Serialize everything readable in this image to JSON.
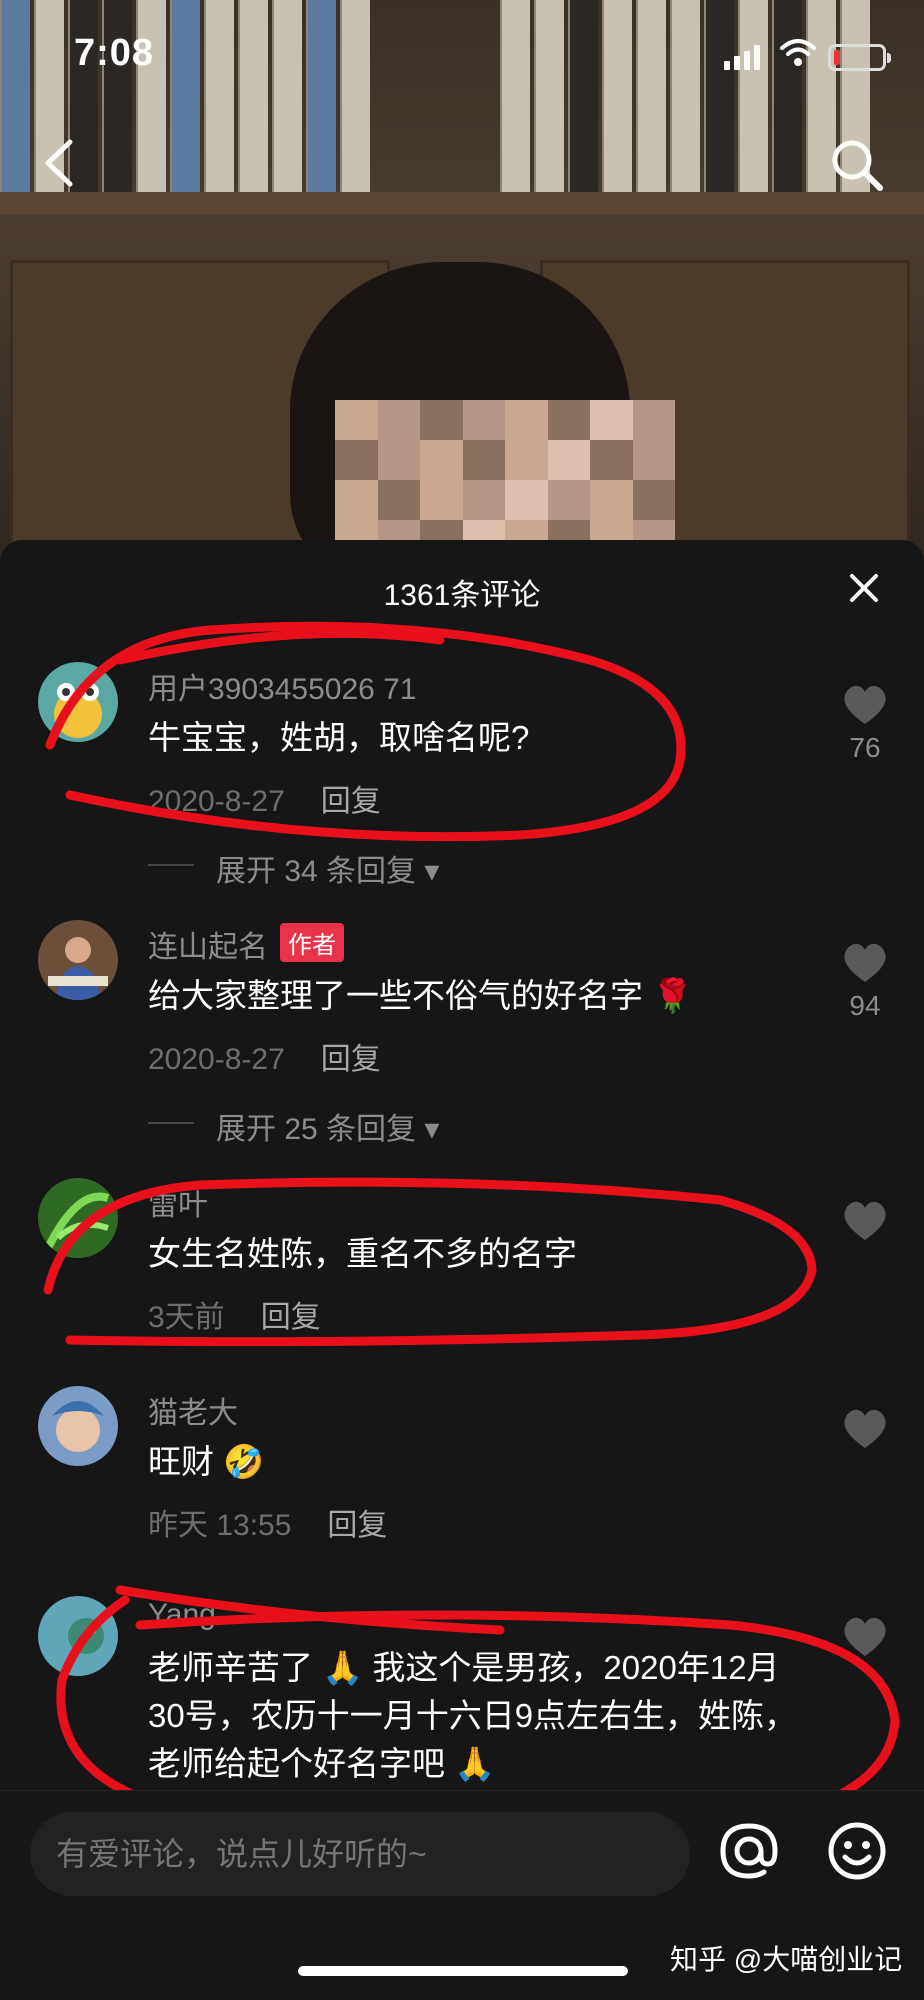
{
  "status_bar": {
    "time": "7:08"
  },
  "sheet": {
    "title": "1361条评论"
  },
  "comments": [
    {
      "user": "用户3903455026 71",
      "text": "牛宝宝，姓胡，取啥名呢?",
      "date": "2020-8-27",
      "reply": "回复",
      "likes": "76",
      "expand": "展开 34 条回复"
    },
    {
      "user": "连山起名",
      "badge": "作者",
      "text": "给大家整理了一些不俗气的好名字 🌹",
      "date": "2020-8-27",
      "reply": "回复",
      "likes": "94",
      "expand": "展开 25 条回复"
    },
    {
      "user": "雷叶",
      "text": "女生名姓陈，重名不多的名字",
      "date": "3天前",
      "reply": "回复"
    },
    {
      "user": "猫老大",
      "text": "旺财 🤣",
      "date": "昨天 13:55",
      "reply": "回复"
    },
    {
      "user": "Yang",
      "text": "老师辛苦了 🙏 我这个是男孩，2020年12月30号，农历十一月十六日9点左右生，姓陈，老师给起个好名字吧 🙏"
    }
  ],
  "input": {
    "placeholder": "有爱评论，说点儿好听的~"
  },
  "watermark": "知乎 @大喵创业记",
  "colors": {
    "annotation": "#e8101a",
    "author_badge": "#e8334a",
    "sheet_bg": "#161616"
  }
}
